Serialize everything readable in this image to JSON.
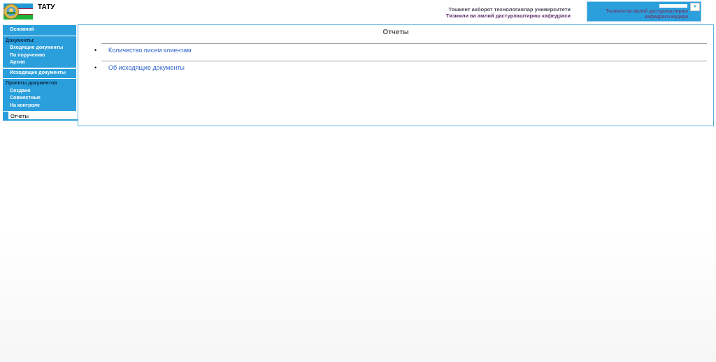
{
  "header": {
    "app_name": "ТАТУ",
    "org_line1": "Тошкент ахборот технологиялар университети",
    "org_line2": "Тизимли ва амлий дастурлаштириш кафедраси",
    "user_role_line1": "Тизимли ва амлий дастурлаштириш",
    "user_role_line2": "кафедраси мудири",
    "dropdown_icon": "▼"
  },
  "sidebar": {
    "main": "Основной",
    "documents_head": "Документы:",
    "incoming": "Входящие документы",
    "by_assignment": "По поручению",
    "archive": "Архив",
    "outgoing": "Исходящие документы",
    "projects_head": "Проекты документов",
    "created": "Создано",
    "joint": "Совместные",
    "on_control": "На контроле",
    "reports": "Отчеты"
  },
  "main": {
    "title": "Отчеты",
    "reports": [
      {
        "label": "Количество писем клиентам"
      },
      {
        "label": "Об исходящие документы"
      }
    ]
  },
  "colors": {
    "accent": "#2a9fdc",
    "link": "#3366cc"
  }
}
